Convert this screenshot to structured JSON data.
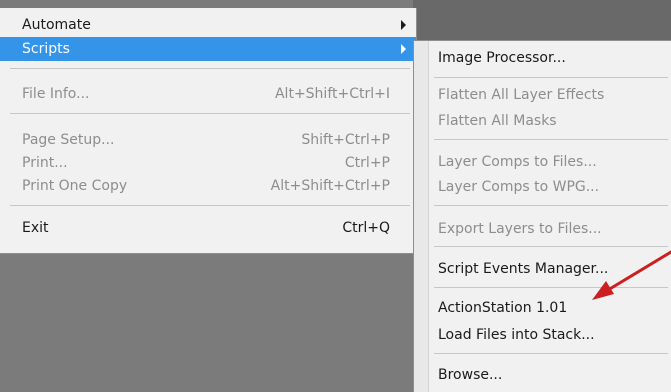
{
  "file_menu": {
    "items": [
      {
        "label": "Automate",
        "shortcut": "",
        "submenu": true,
        "enabled": true,
        "selected": false
      },
      {
        "label": "Scripts",
        "shortcut": "",
        "submenu": true,
        "enabled": true,
        "selected": true
      },
      {
        "label": "File Info...",
        "shortcut": "Alt+Shift+Ctrl+I",
        "enabled": false
      },
      {
        "label": "Page Setup...",
        "shortcut": "Shift+Ctrl+P",
        "enabled": false
      },
      {
        "label": "Print...",
        "shortcut": "Ctrl+P",
        "enabled": false
      },
      {
        "label": "Print One Copy",
        "shortcut": "Alt+Shift+Ctrl+P",
        "enabled": false
      },
      {
        "label": "Exit",
        "shortcut": "Ctrl+Q",
        "enabled": true
      }
    ]
  },
  "scripts_menu": {
    "items": [
      {
        "label": "Image Processor...",
        "enabled": true
      },
      {
        "label": "Flatten All Layer Effects",
        "enabled": false
      },
      {
        "label": "Flatten All Masks",
        "enabled": false
      },
      {
        "label": "Layer Comps to Files...",
        "enabled": false
      },
      {
        "label": "Layer Comps to WPG...",
        "enabled": false
      },
      {
        "label": "Export Layers to Files...",
        "enabled": false
      },
      {
        "label": "Script Events Manager...",
        "enabled": true
      },
      {
        "label": "ActionStation 1.01",
        "enabled": true
      },
      {
        "label": "Load Files into Stack...",
        "enabled": true
      },
      {
        "label": "Browse...",
        "enabled": true
      }
    ]
  },
  "colors": {
    "highlight": "#3394e8",
    "annotation_arrow": "#cc1f1f"
  }
}
